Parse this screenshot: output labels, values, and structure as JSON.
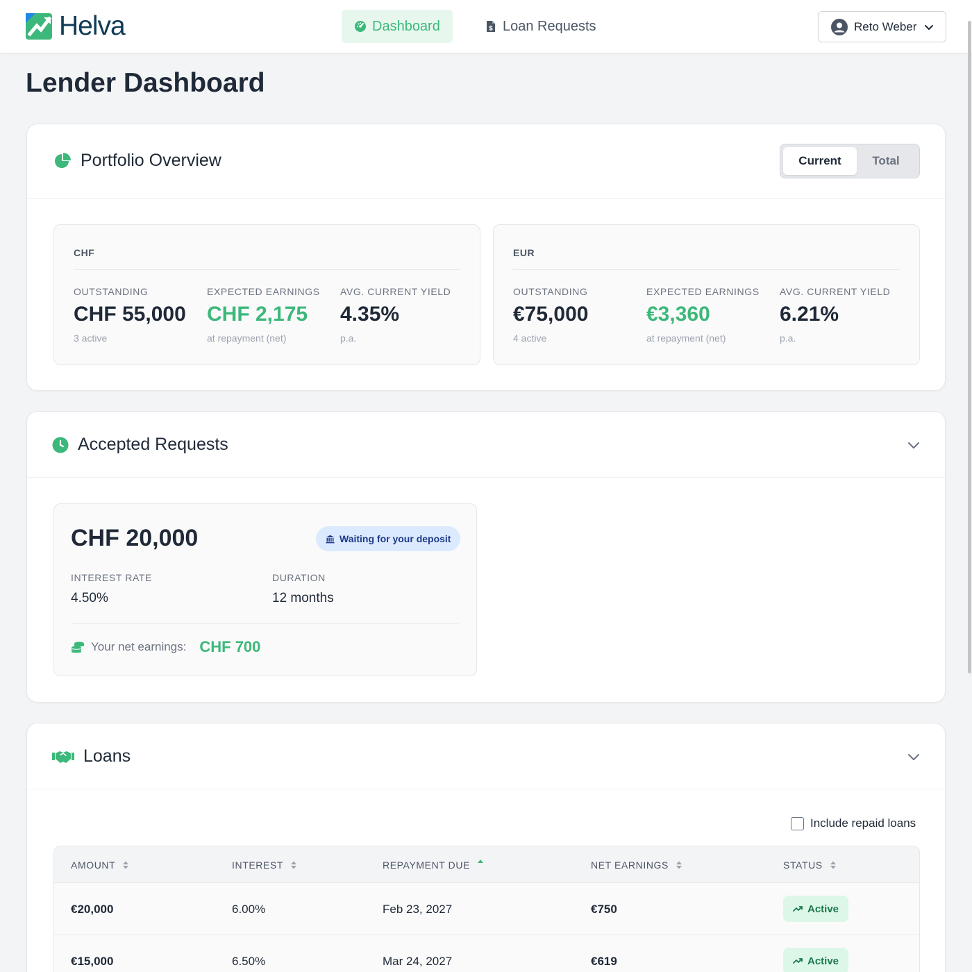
{
  "app": {
    "brand": "Helva",
    "page_title": "Lender Dashboard"
  },
  "nav": {
    "items": [
      {
        "label": "Dashboard",
        "icon": "gauge-icon",
        "active": true
      },
      {
        "label": "Loan Requests",
        "icon": "document-dollar-icon",
        "active": false
      }
    ],
    "user": {
      "name": "Reto Weber",
      "icon": "user-circle-icon"
    }
  },
  "colors": {
    "accent": "#3cb87a",
    "brand": "#0f3b57",
    "info": "#1e3a8a"
  },
  "portfolio": {
    "title": "Portfolio Overview",
    "toggle": {
      "selected": "Current",
      "options": [
        "Current",
        "Total"
      ]
    },
    "currencies": [
      {
        "code": "CHF",
        "outstanding": {
          "label": "OUTSTANDING",
          "value": "CHF 55,000",
          "sub": "3 active"
        },
        "earnings": {
          "label": "EXPECTED EARNINGS",
          "value": "CHF 2,175",
          "sub": "at repayment (net)"
        },
        "yield": {
          "label": "AVG. CURRENT YIELD",
          "value": "4.35%",
          "sub": "p.a."
        }
      },
      {
        "code": "EUR",
        "outstanding": {
          "label": "OUTSTANDING",
          "value": "€75,000",
          "sub": "4 active"
        },
        "earnings": {
          "label": "EXPECTED EARNINGS",
          "value": "€3,360",
          "sub": "at repayment (net)"
        },
        "yield": {
          "label": "AVG. CURRENT YIELD",
          "value": "6.21%",
          "sub": "p.a."
        }
      }
    ]
  },
  "accepted": {
    "title": "Accepted Requests",
    "request": {
      "amount": "CHF 20,000",
      "status": "Waiting for your deposit",
      "interest_label": "INTEREST RATE",
      "interest_value": "4.50%",
      "duration_label": "DURATION",
      "duration_value": "12 months",
      "earnings_label": "Your net earnings:",
      "earnings_value": "CHF 700"
    }
  },
  "loans": {
    "title": "Loans",
    "include_repaid_label": "Include repaid loans",
    "include_repaid_checked": false,
    "columns": [
      "AMOUNT",
      "INTEREST",
      "REPAYMENT DUE",
      "NET EARNINGS",
      "STATUS"
    ],
    "sorted_column": "REPAYMENT DUE",
    "sort_direction": "ascending",
    "rows": [
      {
        "amount": "€20,000",
        "interest": "6.00%",
        "due": "Feb 23, 2027",
        "earnings": "€750",
        "status": "Active"
      },
      {
        "amount": "€15,000",
        "interest": "6.50%",
        "due": "Mar 24, 2027",
        "earnings": "€619",
        "status": "Active"
      }
    ]
  }
}
